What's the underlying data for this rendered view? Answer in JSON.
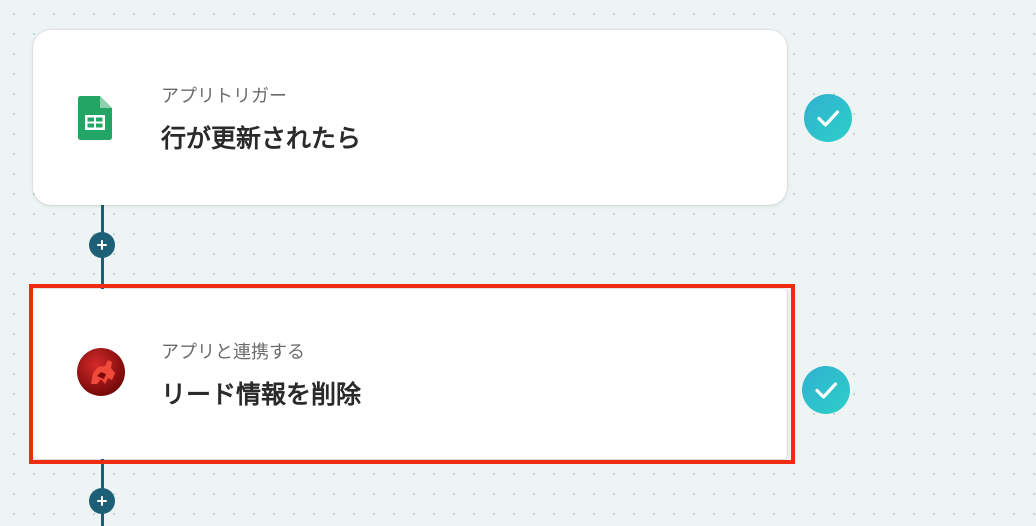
{
  "steps": [
    {
      "label": "アプリトリガー",
      "title": "行が更新されたら",
      "app_icon": "google-sheets-icon",
      "status": "checkmark-icon",
      "icon_color": "#23a566"
    },
    {
      "label": "アプリと連携する",
      "title": "リード情報を削除",
      "app_icon": "app-logo-icon",
      "status": "checkmark-icon",
      "icon_color": "#b31010"
    }
  ],
  "add_step_icon": "plus-icon",
  "colors": {
    "connector": "#1d5f77",
    "check_start": "#30b0d0",
    "check_end": "#2dd0c8",
    "highlight": "#ef2b11",
    "background": "#eef3f3"
  }
}
